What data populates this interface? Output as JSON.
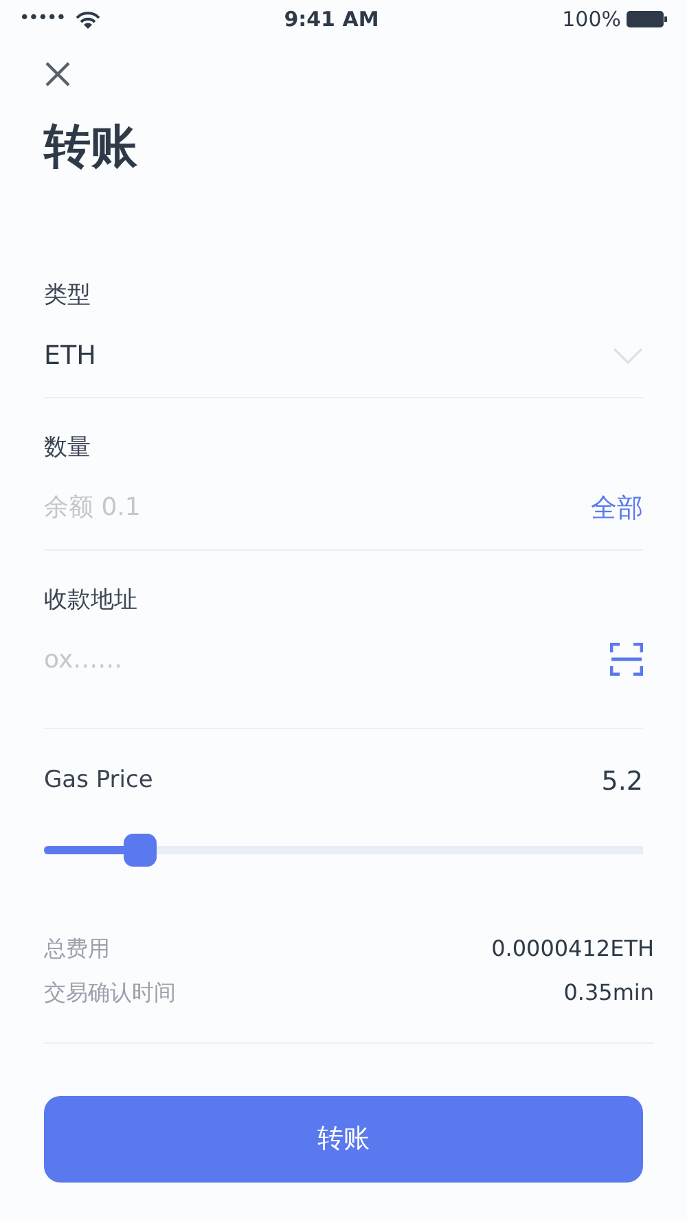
{
  "status_bar": {
    "signal": "•••••",
    "time": "9:41 AM",
    "battery": "100%"
  },
  "title": "转账",
  "type_field": {
    "label": "类型",
    "value": "ETH"
  },
  "amount_field": {
    "label": "数量",
    "placeholder": "余额 0.1",
    "action": "全部"
  },
  "address_field": {
    "label": "收款地址",
    "placeholder": "ox……"
  },
  "gas_price": {
    "label": "Gas Price",
    "reading": "5.2",
    "level": 0.16
  },
  "summary": [
    {
      "label": "总费用",
      "value": "0.0000412ETH"
    },
    {
      "label": "交易确认时间",
      "value": "0.35min"
    }
  ],
  "submit_button": "转账"
}
